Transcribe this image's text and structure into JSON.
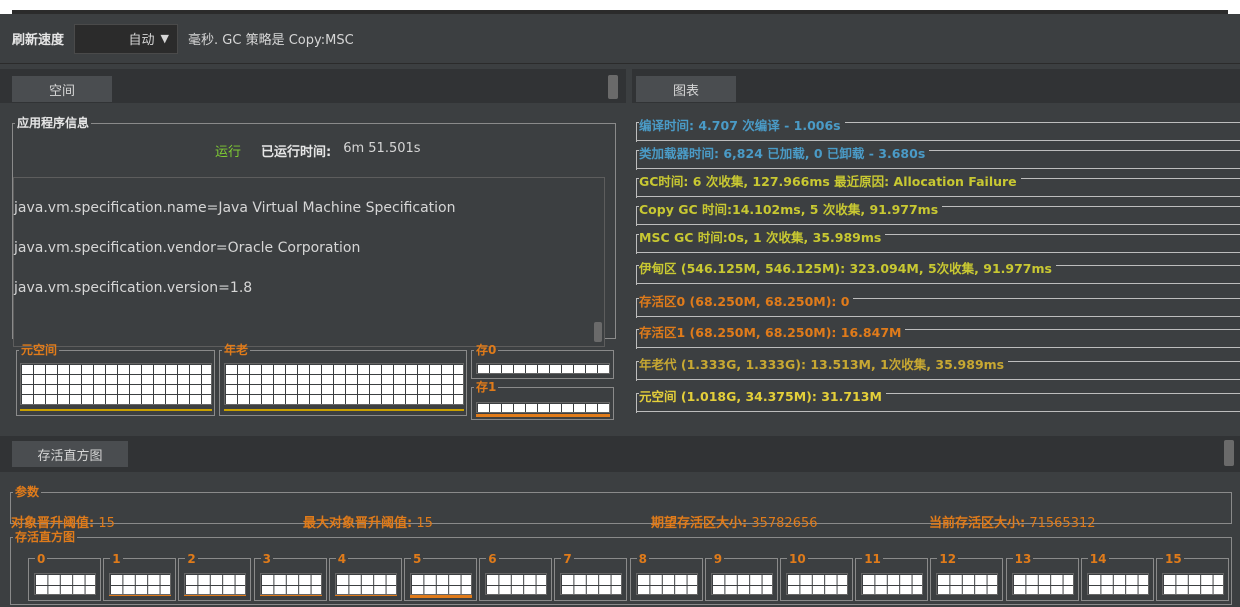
{
  "toolbar": {
    "refresh_label": "刷新速度",
    "refresh_value": "自动",
    "gc_info": "毫秒. GC 策略是 Copy:MSC"
  },
  "tabs": {
    "space": "空间",
    "graph": "图表",
    "histogram": "存活直方图"
  },
  "app_info": {
    "title": "应用程序信息",
    "status": "运行",
    "uptime_label": "已运行时间:",
    "uptime_value": "6m 51.501s",
    "properties": [
      "java.vm.specification.name=Java Virtual Machine Specification",
      "java.vm.specification.vendor=Oracle Corporation",
      "java.vm.specification.version=1.8"
    ]
  },
  "spaces": {
    "metaspace": "元空间",
    "old": "年老",
    "s0": "存0",
    "s1": "存1"
  },
  "graphs": [
    {
      "text": "编译时间: 4.707 次编译 - 1.006s",
      "color": "#4a9bc7"
    },
    {
      "text": "类加载器时间: 6,824 已加载, 0 已卸载 - 3.680s",
      "color": "#4a9bc7"
    },
    {
      "text": "GC时间: 6 次收集, 127.966ms 最近原因: Allocation Failure",
      "color": "#c8c832"
    },
    {
      "text": "Copy GC 时间:14.102ms, 5 次收集, 91.977ms",
      "color": "#c8c832"
    },
    {
      "text": "MSC GC 时间:0s, 1 次收集, 35.989ms",
      "color": "#c8c832"
    },
    {
      "text": "伊甸区 (546.125M, 546.125M): 323.094M, 5次收集, 91.977ms",
      "color": "#c8c832"
    },
    {
      "text": "存活区0 (68.250M, 68.250M): 0",
      "color": "#e07b1a"
    },
    {
      "text": "存活区1 (68.250M, 68.250M): 16.847M",
      "color": "#e07b1a"
    },
    {
      "text": "年老代 (1.333G, 1.333G): 13.513M, 1次收集, 35.989ms",
      "color": "#c8a832"
    },
    {
      "text": "元空间 (1.018G, 34.375M): 31.713M",
      "color": "#e4cf3a"
    }
  ],
  "params": {
    "title": "参数",
    "tenuring_label": "对象晋升阈值:",
    "tenuring_value": "15",
    "max_tenuring_label": "最大对象晋升阈值:",
    "max_tenuring_value": "15",
    "desired_label": "期望存活区大小:",
    "desired_value": "35782656",
    "current_label": "当前存活区大小:",
    "current_value": "71565312"
  },
  "histogram": {
    "title": "存活直方图",
    "buckets": [
      {
        "label": "0",
        "level": 0.0
      },
      {
        "label": "1",
        "level": 0.15
      },
      {
        "label": "2",
        "level": 0.1
      },
      {
        "label": "3",
        "level": 0.15
      },
      {
        "label": "4",
        "level": 0.05
      },
      {
        "label": "5",
        "level": 0.35
      },
      {
        "label": "6",
        "level": 0.0
      },
      {
        "label": "7",
        "level": 0.0
      },
      {
        "label": "8",
        "level": 0.0
      },
      {
        "label": "9",
        "level": 0.0
      },
      {
        "label": "10",
        "level": 0.0
      },
      {
        "label": "11",
        "level": 0.0
      },
      {
        "label": "12",
        "level": 0.0
      },
      {
        "label": "13",
        "level": 0.0
      },
      {
        "label": "14",
        "level": 0.0
      },
      {
        "label": "15",
        "level": 0.0
      }
    ]
  }
}
